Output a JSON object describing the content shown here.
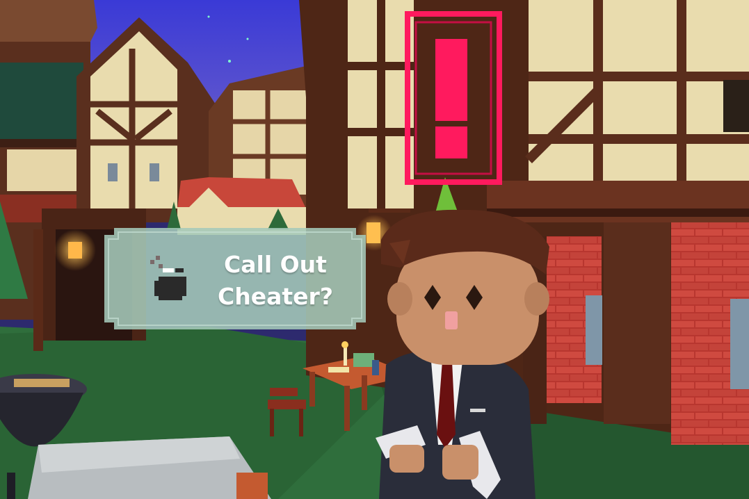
{
  "prompt": {
    "line1": "Call Out",
    "line2": "Cheater?",
    "icon": "bomb-icon"
  },
  "alert": {
    "icon": "exclamation-icon",
    "color": "#ff1a5e"
  },
  "colors": {
    "sky": "#3c3fd0",
    "grass": "#2f6e3c",
    "bubble": "#9fc4b6",
    "timber": "#5a2d1c",
    "plaster": "#e9dcae",
    "brick": "#c23a34"
  }
}
